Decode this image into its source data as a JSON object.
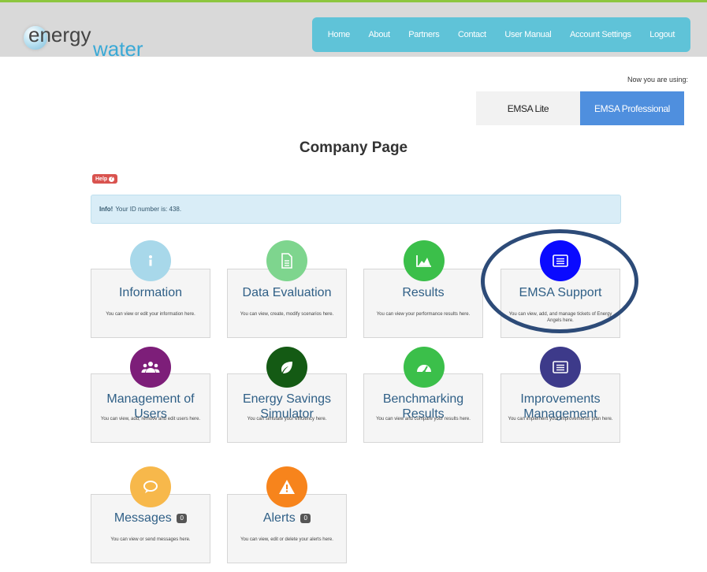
{
  "logo": {
    "word1": "energy",
    "word2": "water"
  },
  "nav": {
    "items": [
      "Home",
      "About",
      "Partners",
      "Contact",
      "User Manual",
      "Account Settings",
      "Logout"
    ]
  },
  "version_switch": {
    "label": "Now you are using:",
    "options": [
      "EMSA Lite",
      "EMSA Professional"
    ],
    "active": "EMSA Professional"
  },
  "page": {
    "title": "Company Page",
    "help_label": "Help"
  },
  "info": {
    "strong": "Info!",
    "text": "Your ID number is: 438."
  },
  "cards": [
    {
      "title": "Information",
      "desc": "You can view or edit your information here.",
      "icon": "info-icon",
      "color": "#a8d8ea"
    },
    {
      "title": "Data Evaluation",
      "desc": "You can view, create, modify scenarios here.",
      "icon": "document-icon",
      "color": "#7ed58e"
    },
    {
      "title": "Results",
      "desc": "You can view your performance results here.",
      "icon": "area-chart-icon",
      "color": "#3bbf4a"
    },
    {
      "title": "EMSA Support",
      "desc": "You can view, add, and manage tickets of Energy Angels here.",
      "icon": "list-icon",
      "color": "#0a0aff"
    },
    {
      "title": "Management of Users",
      "desc": "You can view, add, remove and edit users here.",
      "icon": "users-icon",
      "color": "#7d1e79"
    },
    {
      "title": "Energy Savings Simulator",
      "desc": "You can simulate your efficiency here.",
      "icon": "leaf-icon",
      "color": "#145a14"
    },
    {
      "title": "Benchmarking Results",
      "desc": "You can view and compare your results here.",
      "icon": "dashboard-icon",
      "color": "#3bbf4a"
    },
    {
      "title": "Improvements Management",
      "desc": "You can implement your improvements' plan here.",
      "icon": "list-icon",
      "color": "#3d3a8a"
    },
    {
      "title": "Messages",
      "desc": "You can view or send messages here.",
      "icon": "chat-icon",
      "color": "#f7b84b",
      "badge": "0"
    },
    {
      "title": "Alerts",
      "desc": "You can view, edit or delete your alerts here.",
      "icon": "warning-icon",
      "color": "#f7841c",
      "badge": "0"
    }
  ]
}
